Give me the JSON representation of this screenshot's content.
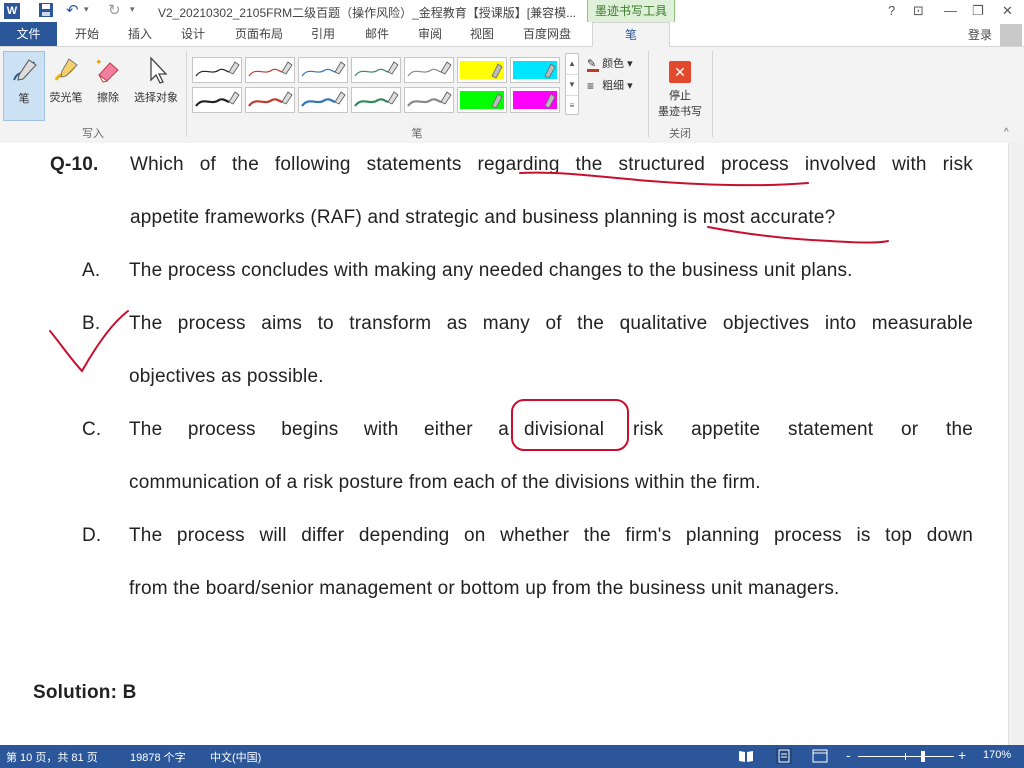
{
  "titlebar": {
    "title": "V2_20210302_2105FRM二级百题（操作风险）_金程教育【授课版】[兼容模...",
    "ink_tools": "墨迹书写工具",
    "help": "?",
    "restore_ribbon": "⊡",
    "minimize": "—",
    "maximize": "❐",
    "close": "✕"
  },
  "tabs": {
    "file": "文件",
    "items": [
      "开始",
      "插入",
      "设计",
      "页面布局",
      "引用",
      "邮件",
      "审阅",
      "视图",
      "百度网盘",
      "笔"
    ],
    "login": "登录"
  },
  "ribbon": {
    "write_group": {
      "label": "写入",
      "buttons": [
        "笔",
        "荧光笔",
        "擦除",
        "选择对象"
      ]
    },
    "pens_group": {
      "label": "笔"
    },
    "color_label": "颜色",
    "weight_label": "粗细",
    "close_group": {
      "label": "关闭",
      "stop_line1": "停止",
      "stop_line2": "墨迹书写"
    },
    "pen_colors_row1": [
      "#222222",
      "#c0392b",
      "#2e74b5",
      "#2e8b57",
      "#888888",
      "#ffff00",
      "#00e5ff"
    ],
    "pen_colors_row2": [
      "#222222",
      "#c0392b",
      "#2e74b5",
      "#2e8b57",
      "#888888",
      "#00ff00",
      "#ff00ff"
    ],
    "accent_color": "#2b579a",
    "ink_color": "#c8102e"
  },
  "document": {
    "question_number": "Q-10.",
    "question_line1": "Which of the following statements regarding the structured process involved with risk",
    "question_line2": "appetite frameworks (RAF) and strategic and business planning is most accurate?",
    "option_a_label": "A.",
    "option_a_line1": "The process concludes with making any needed changes to the business unit plans.",
    "option_b_label": "B.",
    "option_b_line1": "The process aims to transform as many of the qualitative objectives into measurable",
    "option_b_line2": "objectives as possible.",
    "option_c_label": "C.",
    "option_c_line1_a": "The process begins with either a",
    "option_c_line1_b": "divisional",
    "option_c_line1_c": "risk appetite statement or the",
    "option_c_line2": "communication of a risk posture from each of the divisions within the firm.",
    "option_d_label": "D.",
    "option_d_line1": "The process will differ depending on whether the firm's planning process is top down",
    "option_d_line2": "from the board/senior management or bottom up from the business unit managers.",
    "solution": "Solution: B"
  },
  "statusbar": {
    "page": "第 10 页，共 81 页",
    "words": "19878 个字",
    "language": "中文(中国)",
    "zoom_minus": "-",
    "zoom_plus": "+",
    "zoom": "170%",
    "zoom_level": 0.68
  }
}
